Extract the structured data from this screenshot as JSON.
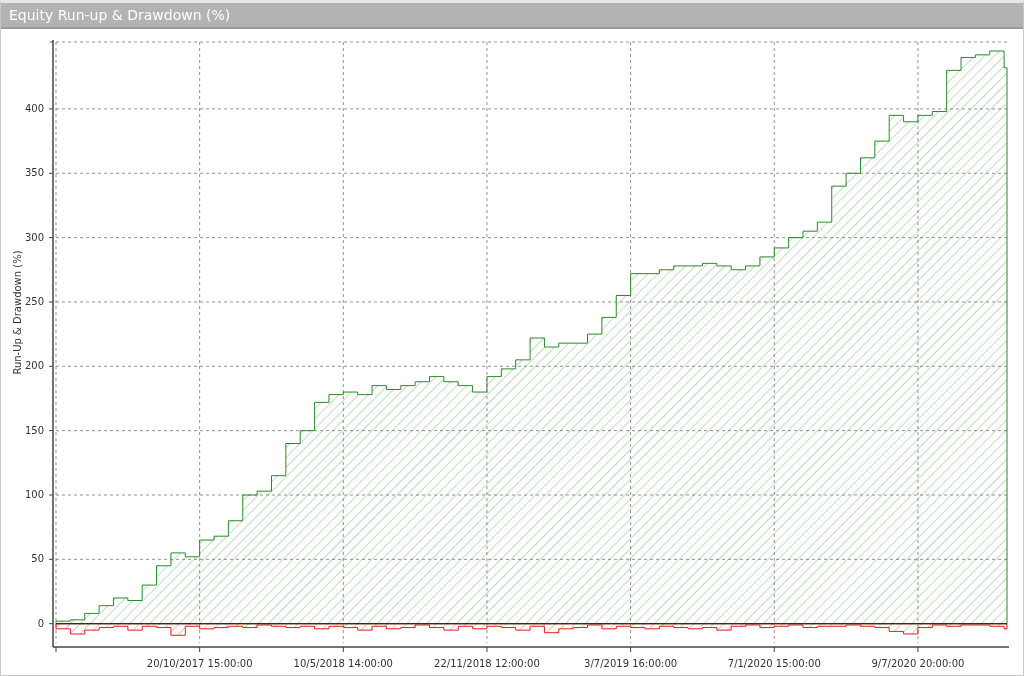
{
  "window": {
    "title": "Equity Run-up & Drawdown (%)"
  },
  "chart_data": {
    "type": "area",
    "ylabel": "Run-Up & Drawdown (%)",
    "categories": [
      null,
      null,
      null,
      null,
      null,
      null,
      null,
      null,
      null,
      null,
      "20/10/2017 15:00:00",
      null,
      null,
      null,
      null,
      null,
      null,
      null,
      null,
      null,
      "10/5/2018 14:00:00",
      null,
      null,
      null,
      null,
      null,
      null,
      null,
      null,
      null,
      "22/11/2018 12:00:00",
      null,
      null,
      null,
      null,
      null,
      null,
      null,
      null,
      null,
      "3/7/2019 16:00:00",
      null,
      null,
      null,
      null,
      null,
      null,
      null,
      null,
      null,
      "7/1/2020 15:00:00",
      null,
      null,
      null,
      null,
      null,
      null,
      null,
      null,
      null,
      "9/7/2020 20:00:00",
      null,
      null,
      null,
      null,
      null,
      null
    ],
    "series": [
      {
        "color": "#2a8a2a",
        "values": [
          2,
          3,
          8,
          14,
          20,
          18,
          30,
          45,
          55,
          52,
          65,
          68,
          80,
          100,
          103,
          115,
          140,
          150,
          172,
          178,
          180,
          178,
          185,
          182,
          185,
          188,
          192,
          188,
          185,
          180,
          192,
          198,
          205,
          222,
          215,
          218,
          218,
          225,
          238,
          255,
          272,
          272,
          275,
          278,
          278,
          280,
          278,
          275,
          278,
          285,
          292,
          300,
          305,
          312,
          340,
          350,
          362,
          375,
          395,
          390,
          395,
          398,
          430,
          440,
          442,
          445,
          432
        ]
      },
      {
        "color": "#e02020",
        "values": [
          -4,
          -8,
          -5,
          -3,
          -2,
          -5,
          -2,
          -3,
          -9,
          -2,
          -4,
          -3,
          -2,
          -3,
          -1,
          -2,
          -3,
          -2,
          -4,
          -2,
          -3,
          -5,
          -2,
          -4,
          -3,
          -1,
          -3,
          -5,
          -2,
          -4,
          -2,
          -3,
          -5,
          -2,
          -7,
          -4,
          -3,
          -1,
          -4,
          -2,
          -3,
          -4,
          -2,
          -3,
          -4,
          -3,
          -5,
          -2,
          -1,
          -3,
          -2,
          -1,
          -3,
          -2,
          -2,
          -1,
          -2,
          -3,
          -6,
          -8,
          -3,
          -1,
          -2,
          -1,
          -1,
          -2,
          -4
        ]
      }
    ],
    "ylim": [
      -15,
      452
    ],
    "grid": true,
    "yticks": [
      0,
      50,
      100,
      150,
      200,
      250,
      300,
      350,
      400
    ]
  }
}
